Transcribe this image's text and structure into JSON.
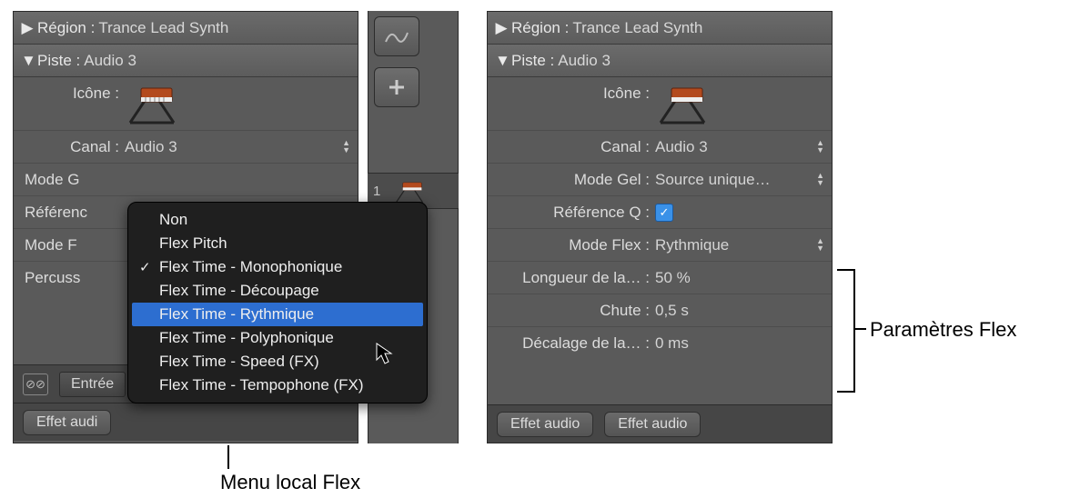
{
  "left": {
    "region_label": "Région :",
    "region_value": "Trance Lead Synth",
    "track_label": "Piste :",
    "track_value": "Audio 3",
    "icon_label": "Icône :",
    "channel_label": "Canal :",
    "channel_value": "Audio 3",
    "mode_g_label": "Mode G",
    "ref_q_label": "Référenc",
    "mode_f_label": "Mode F",
    "percuss_label": "Percuss",
    "entree_label": "Entrée",
    "effet_label": "Effet audi",
    "track_number": "1"
  },
  "menu": {
    "items": [
      {
        "label": "Non",
        "checked": false,
        "selected": false
      },
      {
        "label": "Flex Pitch",
        "checked": false,
        "selected": false
      },
      {
        "label": "Flex Time - Monophonique",
        "checked": true,
        "selected": false
      },
      {
        "label": "Flex Time - Découpage",
        "checked": false,
        "selected": false
      },
      {
        "label": "Flex Time - Rythmique",
        "checked": false,
        "selected": true
      },
      {
        "label": "Flex Time - Polyphonique",
        "checked": false,
        "selected": false
      },
      {
        "label": "Flex Time - Speed (FX)",
        "checked": false,
        "selected": false
      },
      {
        "label": "Flex Time - Tempophone (FX)",
        "checked": false,
        "selected": false
      }
    ]
  },
  "right": {
    "region_label": "Région :",
    "region_value": "Trance Lead Synth",
    "track_label": "Piste :",
    "track_value": "Audio 3",
    "icon_label": "Icône :",
    "channel_label": "Canal :",
    "channel_value": "Audio 3",
    "mode_gel_label": "Mode Gel :",
    "mode_gel_value": "Source unique…",
    "ref_q_label": "Référence Q :",
    "mode_flex_label": "Mode Flex :",
    "mode_flex_value": "Rythmique",
    "longueur_label": "Longueur de la… :",
    "longueur_value": "50 %",
    "chute_label": "Chute :",
    "chute_value": "0,5 s",
    "decalage_label": "Décalage de la… :",
    "decalage_value": "0 ms",
    "effet_left": "Effet audio",
    "effet_right": "Effet audio"
  },
  "callouts": {
    "menu": "Menu local Flex",
    "params": "Paramètres Flex"
  }
}
